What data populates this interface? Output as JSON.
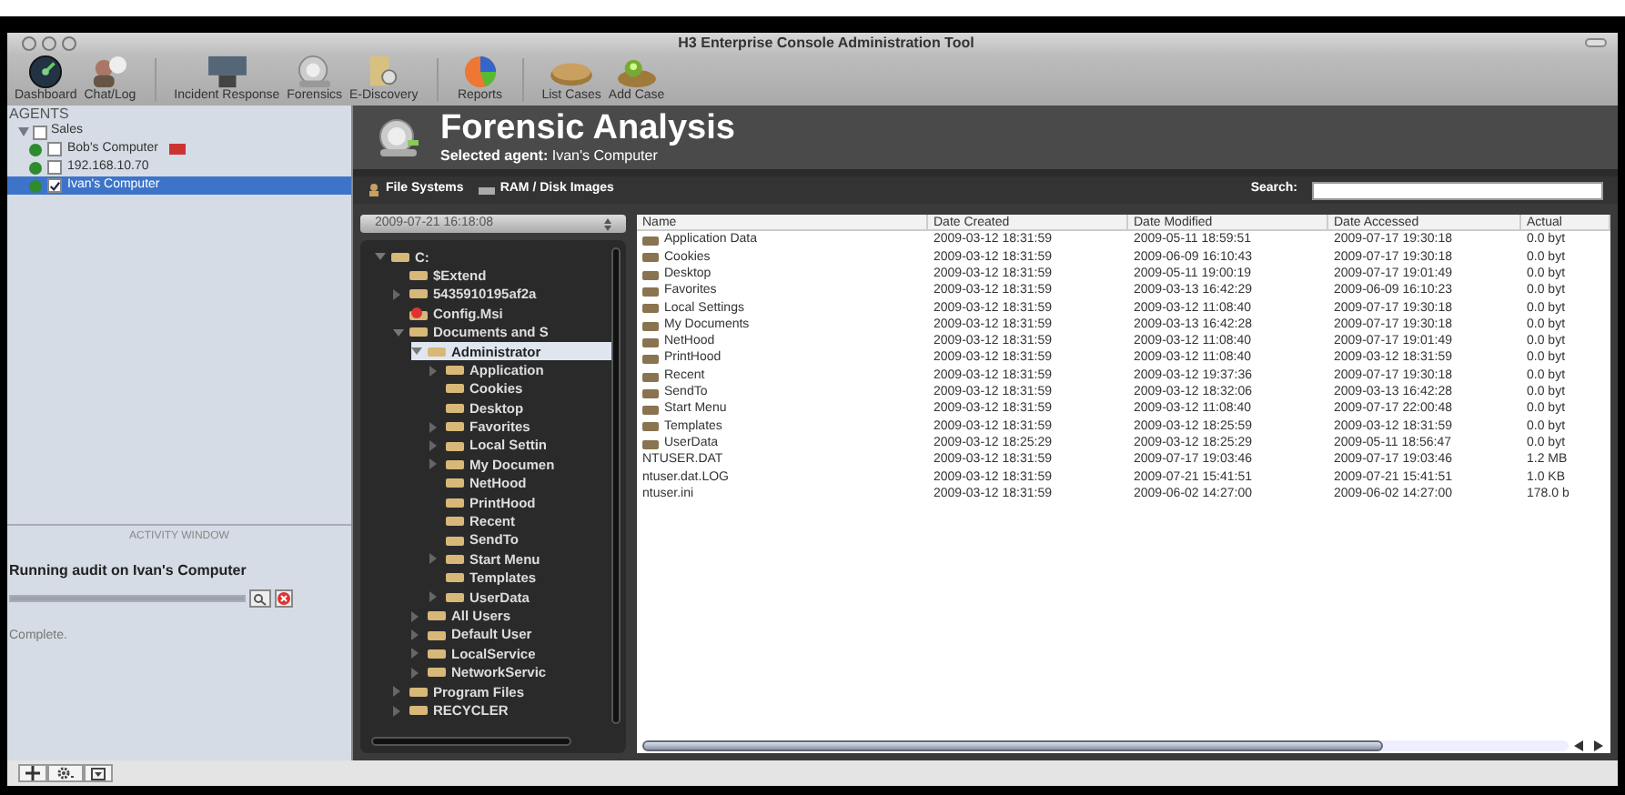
{
  "window": {
    "title": "H3 Enterprise Console Administration Tool"
  },
  "toolbar": [
    {
      "items": [
        {
          "label": "Dashboard",
          "kind": "gauge"
        },
        {
          "label": "Chat/Log",
          "kind": "people"
        }
      ]
    },
    {
      "items": [
        {
          "label": "Incident Response",
          "kind": "monitor"
        },
        {
          "label": "Forensics",
          "kind": "scanner"
        },
        {
          "label": "E-Discovery",
          "kind": "docs"
        }
      ]
    },
    {
      "items": [
        {
          "label": "Reports",
          "kind": "pie"
        }
      ]
    },
    {
      "items": [
        {
          "label": "List Cases",
          "kind": "case"
        },
        {
          "label": "Add Case",
          "kind": "addcase"
        }
      ]
    }
  ],
  "sidebar": {
    "title": "AGENTS",
    "items": [
      {
        "label": "Sales",
        "checked": false,
        "expanded": true,
        "children": [
          {
            "label": "Bob's Computer",
            "checked": false,
            "online": true,
            "flagged": true,
            "selected": false
          },
          {
            "label": "192.168.10.70",
            "checked": false,
            "online": true,
            "flagged": false,
            "selected": false
          },
          {
            "label": "Ivan's Computer",
            "checked": true,
            "online": true,
            "flagged": false,
            "selected": true
          }
        ]
      }
    ]
  },
  "activity": {
    "title": "ACTIVITY WINDOW",
    "task": "Running audit on Ivan's Computer",
    "level": 1,
    "status": "Complete."
  },
  "header": {
    "title": "Forensic Analysis",
    "subtitle": "**Selected agent:** Ivan's Computer"
  },
  "tabs": [
    {
      "label": "File Systems",
      "kind": "files"
    },
    {
      "label": "RAM / Disk Images",
      "kind": "ram"
    }
  ],
  "search": {
    "label": "Search:"
  },
  "snapshot": {
    "value": "2009-07-21 16:18:08"
  },
  "tree": [
    {
      "label": "C:",
      "kind": "drive",
      "expanded": true,
      "children": [
        {
          "label": "$Extend",
          "kind": "folder"
        },
        {
          "label": "5435910195af2a",
          "kind": "folder",
          "expanded": false
        },
        {
          "label": "Config.Msi",
          "kind": "special"
        },
        {
          "label": "Documents and S",
          "kind": "folder",
          "expanded": true,
          "children": [
            {
              "label": "Administrator",
              "kind": "folder",
              "expanded": true,
              "selected": true,
              "children": [
                {
                  "label": "Application",
                  "kind": "folder",
                  "expanded": false
                },
                {
                  "label": "Cookies",
                  "kind": "folder"
                },
                {
                  "label": "Desktop",
                  "kind": "folder"
                },
                {
                  "label": "Favorites",
                  "kind": "folder",
                  "expanded": false
                },
                {
                  "label": "Local Settin",
                  "kind": "folder",
                  "expanded": false
                },
                {
                  "label": "My Documen",
                  "kind": "folder",
                  "expanded": false
                },
                {
                  "label": "NetHood",
                  "kind": "folder"
                },
                {
                  "label": "PrintHood",
                  "kind": "folder"
                },
                {
                  "label": "Recent",
                  "kind": "folder"
                },
                {
                  "label": "SendTo",
                  "kind": "folder"
                },
                {
                  "label": "Start Menu",
                  "kind": "folder",
                  "expanded": false
                },
                {
                  "label": "Templates",
                  "kind": "folder"
                },
                {
                  "label": "UserData",
                  "kind": "folder",
                  "expanded": false
                }
              ]
            },
            {
              "label": "All Users",
              "kind": "folder",
              "expanded": false
            },
            {
              "label": "Default User",
              "kind": "folder",
              "expanded": false
            },
            {
              "label": "LocalService",
              "kind": "folder",
              "expanded": false
            },
            {
              "label": "NetworkServic",
              "kind": "folder",
              "expanded": false
            }
          ]
        },
        {
          "label": "Program Files",
          "kind": "folder",
          "expanded": false
        },
        {
          "label": "RECYCLER",
          "kind": "folder",
          "expanded": false
        }
      ]
    }
  ],
  "table": {
    "columns": [
      "Name",
      "Date Created",
      "Date Modified",
      "Date Accessed",
      "Actual"
    ],
    "rows": [
      {
        "kind": "folder",
        "cells": [
          "Application Data",
          "2009-03-12 18:31:59",
          "2009-05-11 18:59:51",
          "2009-07-17 19:30:18",
          "0.0 byt"
        ]
      },
      {
        "kind": "folder",
        "cells": [
          "Cookies",
          "2009-03-12 18:31:59",
          "2009-06-09 16:10:43",
          "2009-07-17 19:30:18",
          "0.0 byt"
        ]
      },
      {
        "kind": "folder",
        "cells": [
          "Desktop",
          "2009-03-12 18:31:59",
          "2009-05-11 19:00:19",
          "2009-07-17 19:01:49",
          "0.0 byt"
        ]
      },
      {
        "kind": "folder",
        "cells": [
          "Favorites",
          "2009-03-12 18:31:59",
          "2009-03-13 16:42:29",
          "2009-06-09 16:10:23",
          "0.0 byt"
        ]
      },
      {
        "kind": "folder",
        "cells": [
          "Local Settings",
          "2009-03-12 18:31:59",
          "2009-03-12 11:08:40",
          "2009-07-17 19:30:18",
          "0.0 byt"
        ]
      },
      {
        "kind": "folder",
        "cells": [
          "My Documents",
          "2009-03-12 18:31:59",
          "2009-03-13 16:42:28",
          "2009-07-17 19:30:18",
          "0.0 byt"
        ]
      },
      {
        "kind": "folder",
        "cells": [
          "NetHood",
          "2009-03-12 18:31:59",
          "2009-03-12 11:08:40",
          "2009-07-17 19:01:49",
          "0.0 byt"
        ]
      },
      {
        "kind": "folder",
        "cells": [
          "PrintHood",
          "2009-03-12 18:31:59",
          "2009-03-12 11:08:40",
          "2009-03-12 18:31:59",
          "0.0 byt"
        ]
      },
      {
        "kind": "folder",
        "cells": [
          "Recent",
          "2009-03-12 18:31:59",
          "2009-03-12 19:37:36",
          "2009-07-17 19:30:18",
          "0.0 byt"
        ]
      },
      {
        "kind": "folder",
        "cells": [
          "SendTo",
          "2009-03-12 18:31:59",
          "2009-03-12 18:32:06",
          "2009-03-13 16:42:28",
          "0.0 byt"
        ]
      },
      {
        "kind": "folder",
        "cells": [
          "Start Menu",
          "2009-03-12 18:31:59",
          "2009-03-12 11:08:40",
          "2009-07-17 22:00:48",
          "0.0 byt"
        ]
      },
      {
        "kind": "folder",
        "cells": [
          "Templates",
          "2009-03-12 18:31:59",
          "2009-03-12 18:25:59",
          "2009-03-12 18:31:59",
          "0.0 byt"
        ]
      },
      {
        "kind": "folder",
        "cells": [
          "UserData",
          "2009-03-12 18:25:29",
          "2009-03-12 18:25:29",
          "2009-05-11 18:56:47",
          "0.0 byt"
        ]
      },
      {
        "kind": "file",
        "cells": [
          "NTUSER.DAT",
          "2009-03-12 18:31:59",
          "2009-07-17 19:03:46",
          "2009-07-17 19:03:46",
          "1.2 MB"
        ]
      },
      {
        "kind": "file",
        "cells": [
          "ntuser.dat.LOG",
          "2009-03-12 18:31:59",
          "2009-07-21 15:41:51",
          "2009-07-21 15:41:51",
          "1.0 KB"
        ]
      },
      {
        "kind": "file",
        "cells": [
          "ntuser.ini",
          "2009-03-12 18:31:59",
          "2009-06-02 14:27:00",
          "2009-06-02 14:27:00",
          "178.0 b"
        ]
      }
    ]
  }
}
